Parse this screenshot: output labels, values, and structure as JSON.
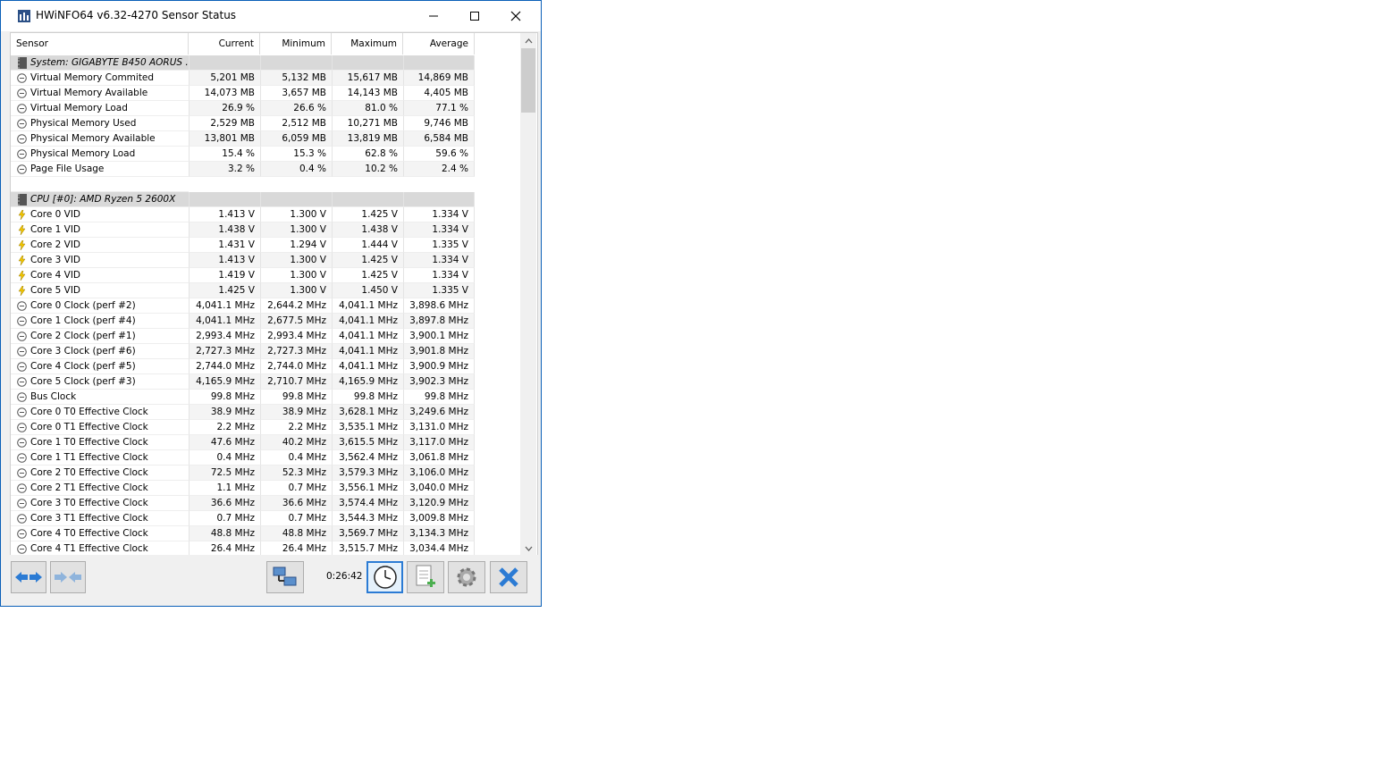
{
  "window": {
    "title": "HWiNFO64 v6.32-4270 Sensor Status"
  },
  "columns": [
    "Sensor",
    "Current",
    "Minimum",
    "Maximum",
    "Average"
  ],
  "rows": [
    {
      "type": "group",
      "name": "System: GIGABYTE B450 AORUS ..."
    },
    {
      "type": "row",
      "icon": "gauge",
      "name": "Virtual Memory Commited",
      "cur": "5,201 MB",
      "min": "5,132 MB",
      "max": "15,617 MB",
      "avg": "14,869 MB"
    },
    {
      "type": "row",
      "icon": "gauge",
      "name": "Virtual Memory Available",
      "cur": "14,073 MB",
      "min": "3,657 MB",
      "max": "14,143 MB",
      "avg": "4,405 MB"
    },
    {
      "type": "row",
      "icon": "gauge",
      "name": "Virtual Memory Load",
      "cur": "26.9 %",
      "min": "26.6 %",
      "max": "81.0 %",
      "avg": "77.1 %"
    },
    {
      "type": "row",
      "icon": "gauge",
      "name": "Physical Memory Used",
      "cur": "2,529 MB",
      "min": "2,512 MB",
      "max": "10,271 MB",
      "avg": "9,746 MB"
    },
    {
      "type": "row",
      "icon": "gauge",
      "name": "Physical Memory Available",
      "cur": "13,801 MB",
      "min": "6,059 MB",
      "max": "13,819 MB",
      "avg": "6,584 MB"
    },
    {
      "type": "row",
      "icon": "gauge",
      "name": "Physical Memory Load",
      "cur": "15.4 %",
      "min": "15.3 %",
      "max": "62.8 %",
      "avg": "59.6 %"
    },
    {
      "type": "row",
      "icon": "gauge",
      "name": "Page File Usage",
      "cur": "3.2 %",
      "min": "0.4 %",
      "max": "10.2 %",
      "avg": "2.4 %"
    },
    {
      "type": "blank"
    },
    {
      "type": "group",
      "name": "CPU [#0]: AMD Ryzen 5 2600X"
    },
    {
      "type": "row",
      "icon": "bolt",
      "name": "Core 0 VID",
      "cur": "1.413 V",
      "min": "1.300 V",
      "max": "1.425 V",
      "avg": "1.334 V"
    },
    {
      "type": "row",
      "icon": "bolt",
      "name": "Core 1 VID",
      "cur": "1.438 V",
      "min": "1.300 V",
      "max": "1.438 V",
      "avg": "1.334 V"
    },
    {
      "type": "row",
      "icon": "bolt",
      "name": "Core 2 VID",
      "cur": "1.431 V",
      "min": "1.294 V",
      "max": "1.444 V",
      "avg": "1.335 V"
    },
    {
      "type": "row",
      "icon": "bolt",
      "name": "Core 3 VID",
      "cur": "1.413 V",
      "min": "1.300 V",
      "max": "1.425 V",
      "avg": "1.334 V"
    },
    {
      "type": "row",
      "icon": "bolt",
      "name": "Core 4 VID",
      "cur": "1.419 V",
      "min": "1.300 V",
      "max": "1.425 V",
      "avg": "1.334 V"
    },
    {
      "type": "row",
      "icon": "bolt",
      "name": "Core 5 VID",
      "cur": "1.425 V",
      "min": "1.300 V",
      "max": "1.450 V",
      "avg": "1.335 V"
    },
    {
      "type": "row",
      "icon": "gauge",
      "name": "Core 0 Clock (perf #2)",
      "cur": "4,041.1 MHz",
      "min": "2,644.2 MHz",
      "max": "4,041.1 MHz",
      "avg": "3,898.6 MHz"
    },
    {
      "type": "row",
      "icon": "gauge",
      "name": "Core 1 Clock (perf #4)",
      "cur": "4,041.1 MHz",
      "min": "2,677.5 MHz",
      "max": "4,041.1 MHz",
      "avg": "3,897.8 MHz"
    },
    {
      "type": "row",
      "icon": "gauge",
      "name": "Core 2 Clock (perf #1)",
      "cur": "2,993.4 MHz",
      "min": "2,993.4 MHz",
      "max": "4,041.1 MHz",
      "avg": "3,900.1 MHz"
    },
    {
      "type": "row",
      "icon": "gauge",
      "name": "Core 3 Clock (perf #6)",
      "cur": "2,727.3 MHz",
      "min": "2,727.3 MHz",
      "max": "4,041.1 MHz",
      "avg": "3,901.8 MHz"
    },
    {
      "type": "row",
      "icon": "gauge",
      "name": "Core 4 Clock (perf #5)",
      "cur": "2,744.0 MHz",
      "min": "2,744.0 MHz",
      "max": "4,041.1 MHz",
      "avg": "3,900.9 MHz"
    },
    {
      "type": "row",
      "icon": "gauge",
      "name": "Core 5 Clock (perf #3)",
      "cur": "4,165.9 MHz",
      "min": "2,710.7 MHz",
      "max": "4,165.9 MHz",
      "avg": "3,902.3 MHz"
    },
    {
      "type": "row",
      "icon": "gauge",
      "name": "Bus Clock",
      "cur": "99.8 MHz",
      "min": "99.8 MHz",
      "max": "99.8 MHz",
      "avg": "99.8 MHz"
    },
    {
      "type": "row",
      "icon": "gauge",
      "name": "Core 0 T0 Effective Clock",
      "cur": "38.9 MHz",
      "min": "38.9 MHz",
      "max": "3,628.1 MHz",
      "avg": "3,249.6 MHz"
    },
    {
      "type": "row",
      "icon": "gauge",
      "name": "Core 0 T1 Effective Clock",
      "cur": "2.2 MHz",
      "min": "2.2 MHz",
      "max": "3,535.1 MHz",
      "avg": "3,131.0 MHz"
    },
    {
      "type": "row",
      "icon": "gauge",
      "name": "Core 1 T0 Effective Clock",
      "cur": "47.6 MHz",
      "min": "40.2 MHz",
      "max": "3,615.5 MHz",
      "avg": "3,117.0 MHz"
    },
    {
      "type": "row",
      "icon": "gauge",
      "name": "Core 1 T1 Effective Clock",
      "cur": "0.4 MHz",
      "min": "0.4 MHz",
      "max": "3,562.4 MHz",
      "avg": "3,061.8 MHz"
    },
    {
      "type": "row",
      "icon": "gauge",
      "name": "Core 2 T0 Effective Clock",
      "cur": "72.5 MHz",
      "min": "52.3 MHz",
      "max": "3,579.3 MHz",
      "avg": "3,106.0 MHz"
    },
    {
      "type": "row",
      "icon": "gauge",
      "name": "Core 2 T1 Effective Clock",
      "cur": "1.1 MHz",
      "min": "0.7 MHz",
      "max": "3,556.1 MHz",
      "avg": "3,040.0 MHz"
    },
    {
      "type": "row",
      "icon": "gauge",
      "name": "Core 3 T0 Effective Clock",
      "cur": "36.6 MHz",
      "min": "36.6 MHz",
      "max": "3,574.4 MHz",
      "avg": "3,120.9 MHz"
    },
    {
      "type": "row",
      "icon": "gauge",
      "name": "Core 3 T1 Effective Clock",
      "cur": "0.7 MHz",
      "min": "0.7 MHz",
      "max": "3,544.3 MHz",
      "avg": "3,009.8 MHz"
    },
    {
      "type": "row",
      "icon": "gauge",
      "name": "Core 4 T0 Effective Clock",
      "cur": "48.8 MHz",
      "min": "48.8 MHz",
      "max": "3,569.7 MHz",
      "avg": "3,134.3 MHz"
    },
    {
      "type": "row",
      "icon": "gauge",
      "name": "Core 4 T1 Effective Clock",
      "cur": "26.4 MHz",
      "min": "26.4 MHz",
      "max": "3,515.7 MHz",
      "avg": "3,034.4 MHz"
    }
  ],
  "toolbar": {
    "timer": "0:26:42",
    "buttons": [
      "nav-arrows-icon",
      "collapse-arrows-icon",
      "network-icon",
      "clock-icon",
      "add-report-icon",
      "settings-icon",
      "close-x-icon"
    ]
  },
  "colors": {
    "accent": "#0a5fb8",
    "group_bg": "#d9d9d9",
    "button_blue": "#2b7bd4"
  }
}
